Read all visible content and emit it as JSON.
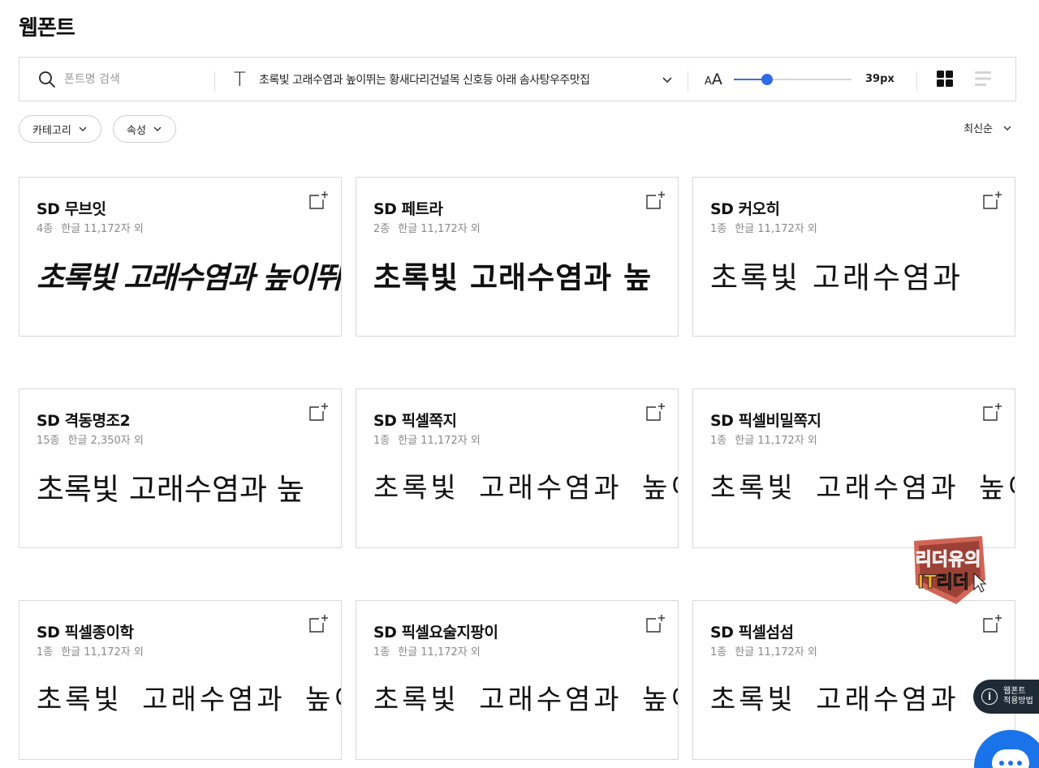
{
  "page": {
    "title": "웹폰트"
  },
  "toolbar": {
    "search_placeholder": "폰트명 검색",
    "text_icon": "T",
    "sample_text": "초록빛 고래수염과 높이뛰는 황새다리건널목 신호등 아래 솜사탕우주맛집",
    "size_icon_small": "A",
    "size_icon_big": "A",
    "size_value": "39px",
    "size_slider_fraction": 0.28,
    "accent_color": "#2f6be5"
  },
  "filters": {
    "category_label": "카테고리",
    "attribute_label": "속성",
    "sort_label": "최신순"
  },
  "cards": [
    {
      "name": "SD 무브잇",
      "styles": "4종",
      "coverage": "한글 11,172자 외",
      "sample": "초록빛 고래수염과 높이뛰는 황"
    },
    {
      "name": "SD 페트라",
      "styles": "2종",
      "coverage": "한글 11,172자 외",
      "sample": "초록빛 고래수염과 높"
    },
    {
      "name": "SD 커오히",
      "styles": "1종",
      "coverage": "한글 11,172자 외",
      "sample": "초록빛 고래수염과"
    },
    {
      "name": "SD 격동명조2",
      "styles": "15종",
      "coverage": "한글 2,350자 외",
      "sample": "초록빛 고래수염과 높"
    },
    {
      "name": "SD 픽셀쪽지",
      "styles": "1종",
      "coverage": "한글 11,172자 외",
      "sample": "초록빛 고래수염과 높이"
    },
    {
      "name": "SD 픽셀비밀쪽지",
      "styles": "1종",
      "coverage": "한글 11,172자 외",
      "sample": "초록빛 고래수염과 높이"
    },
    {
      "name": "SD 픽셀종이학",
      "styles": "1종",
      "coverage": "한글 11,172자 외",
      "sample": "초록빛 고래수염과 높이"
    },
    {
      "name": "SD 픽셀요술지팡이",
      "styles": "1종",
      "coverage": "한글 11,172자 외",
      "sample": "초록빛 고래수염과 높이뛰는"
    },
    {
      "name": "SD 픽셀섬섬",
      "styles": "1종",
      "coverage": "한글 11,172자 외",
      "sample": "초록빛 고래수염과 높"
    }
  ],
  "watermark": {
    "line1": "리더유의",
    "line2": "IT리더"
  },
  "help": {
    "icon": "i",
    "line1": "웹폰트",
    "line2": "적용방법"
  },
  "chat": {
    "icon": "chat-bubble-icon"
  }
}
